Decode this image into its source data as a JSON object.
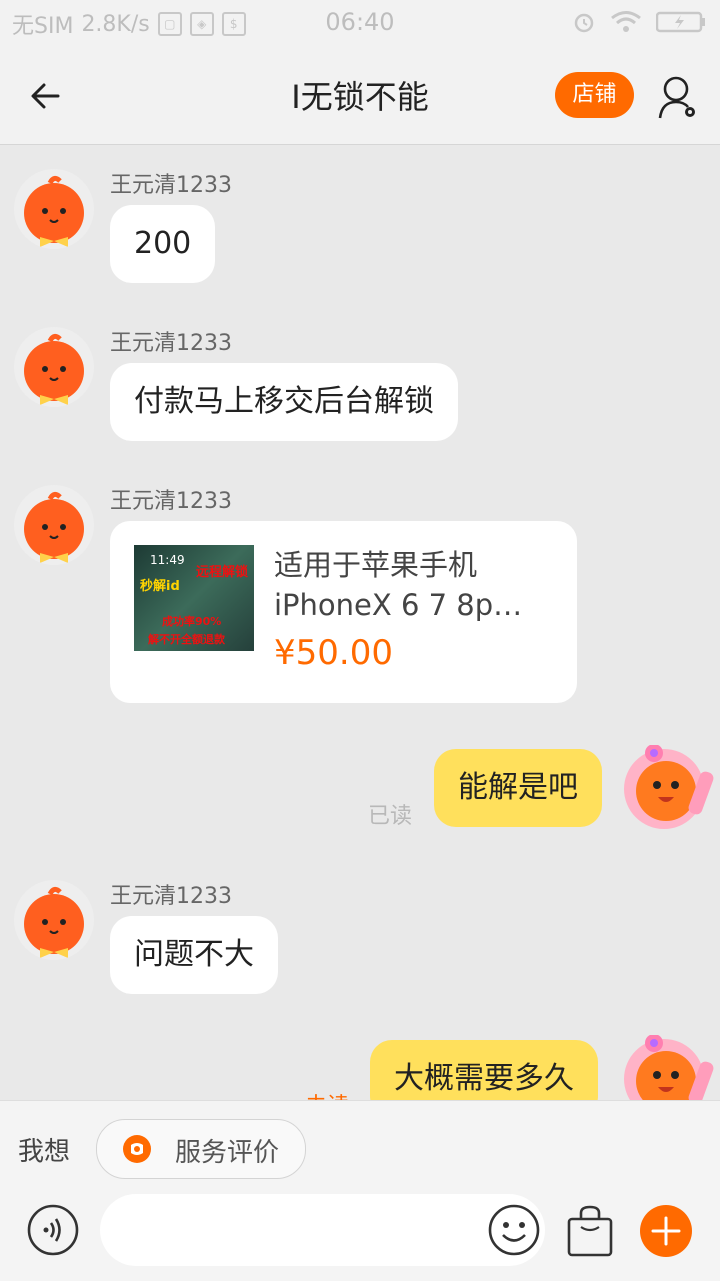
{
  "status_bar": {
    "carrier": "无SIM",
    "speed": "2.8K/s",
    "time": "06:40"
  },
  "header": {
    "title": "I无锁不能",
    "store_label": "店铺",
    "icons": {
      "back": "back-arrow-icon",
      "user": "user-settings-icon"
    }
  },
  "messages": [
    {
      "sender": "王元清1233",
      "text": "200"
    },
    {
      "sender": "王元清1233",
      "text": "付款马上移交后台解锁"
    },
    {
      "sender": "王元清1233",
      "product": {
        "title": "适用于苹果手机iPhoneX 6 7 8p…",
        "price": "¥50.00",
        "image_texts": [
          "11:49",
          "秒解id",
          "远程解锁",
          "成功率90%",
          "解不开全额退款"
        ]
      }
    },
    {
      "mine": true,
      "text": "能解是吧",
      "read_status": "已读"
    },
    {
      "sender": "王元清1233",
      "text": "问题不大"
    },
    {
      "mine": true,
      "text": "大概需要多久",
      "read_status": "未读"
    }
  ],
  "bottom": {
    "want_label": "我想",
    "service_label": "服务评价",
    "input_placeholder": "",
    "icons": {
      "voice": "voice-icon",
      "emoji": "emoji-icon",
      "bag": "shopping-bag-icon",
      "plus": "plus-icon"
    }
  },
  "colors": {
    "accent": "#ff6a00",
    "my_bubble": "#ffe05c",
    "background": "#e9e9e9"
  }
}
